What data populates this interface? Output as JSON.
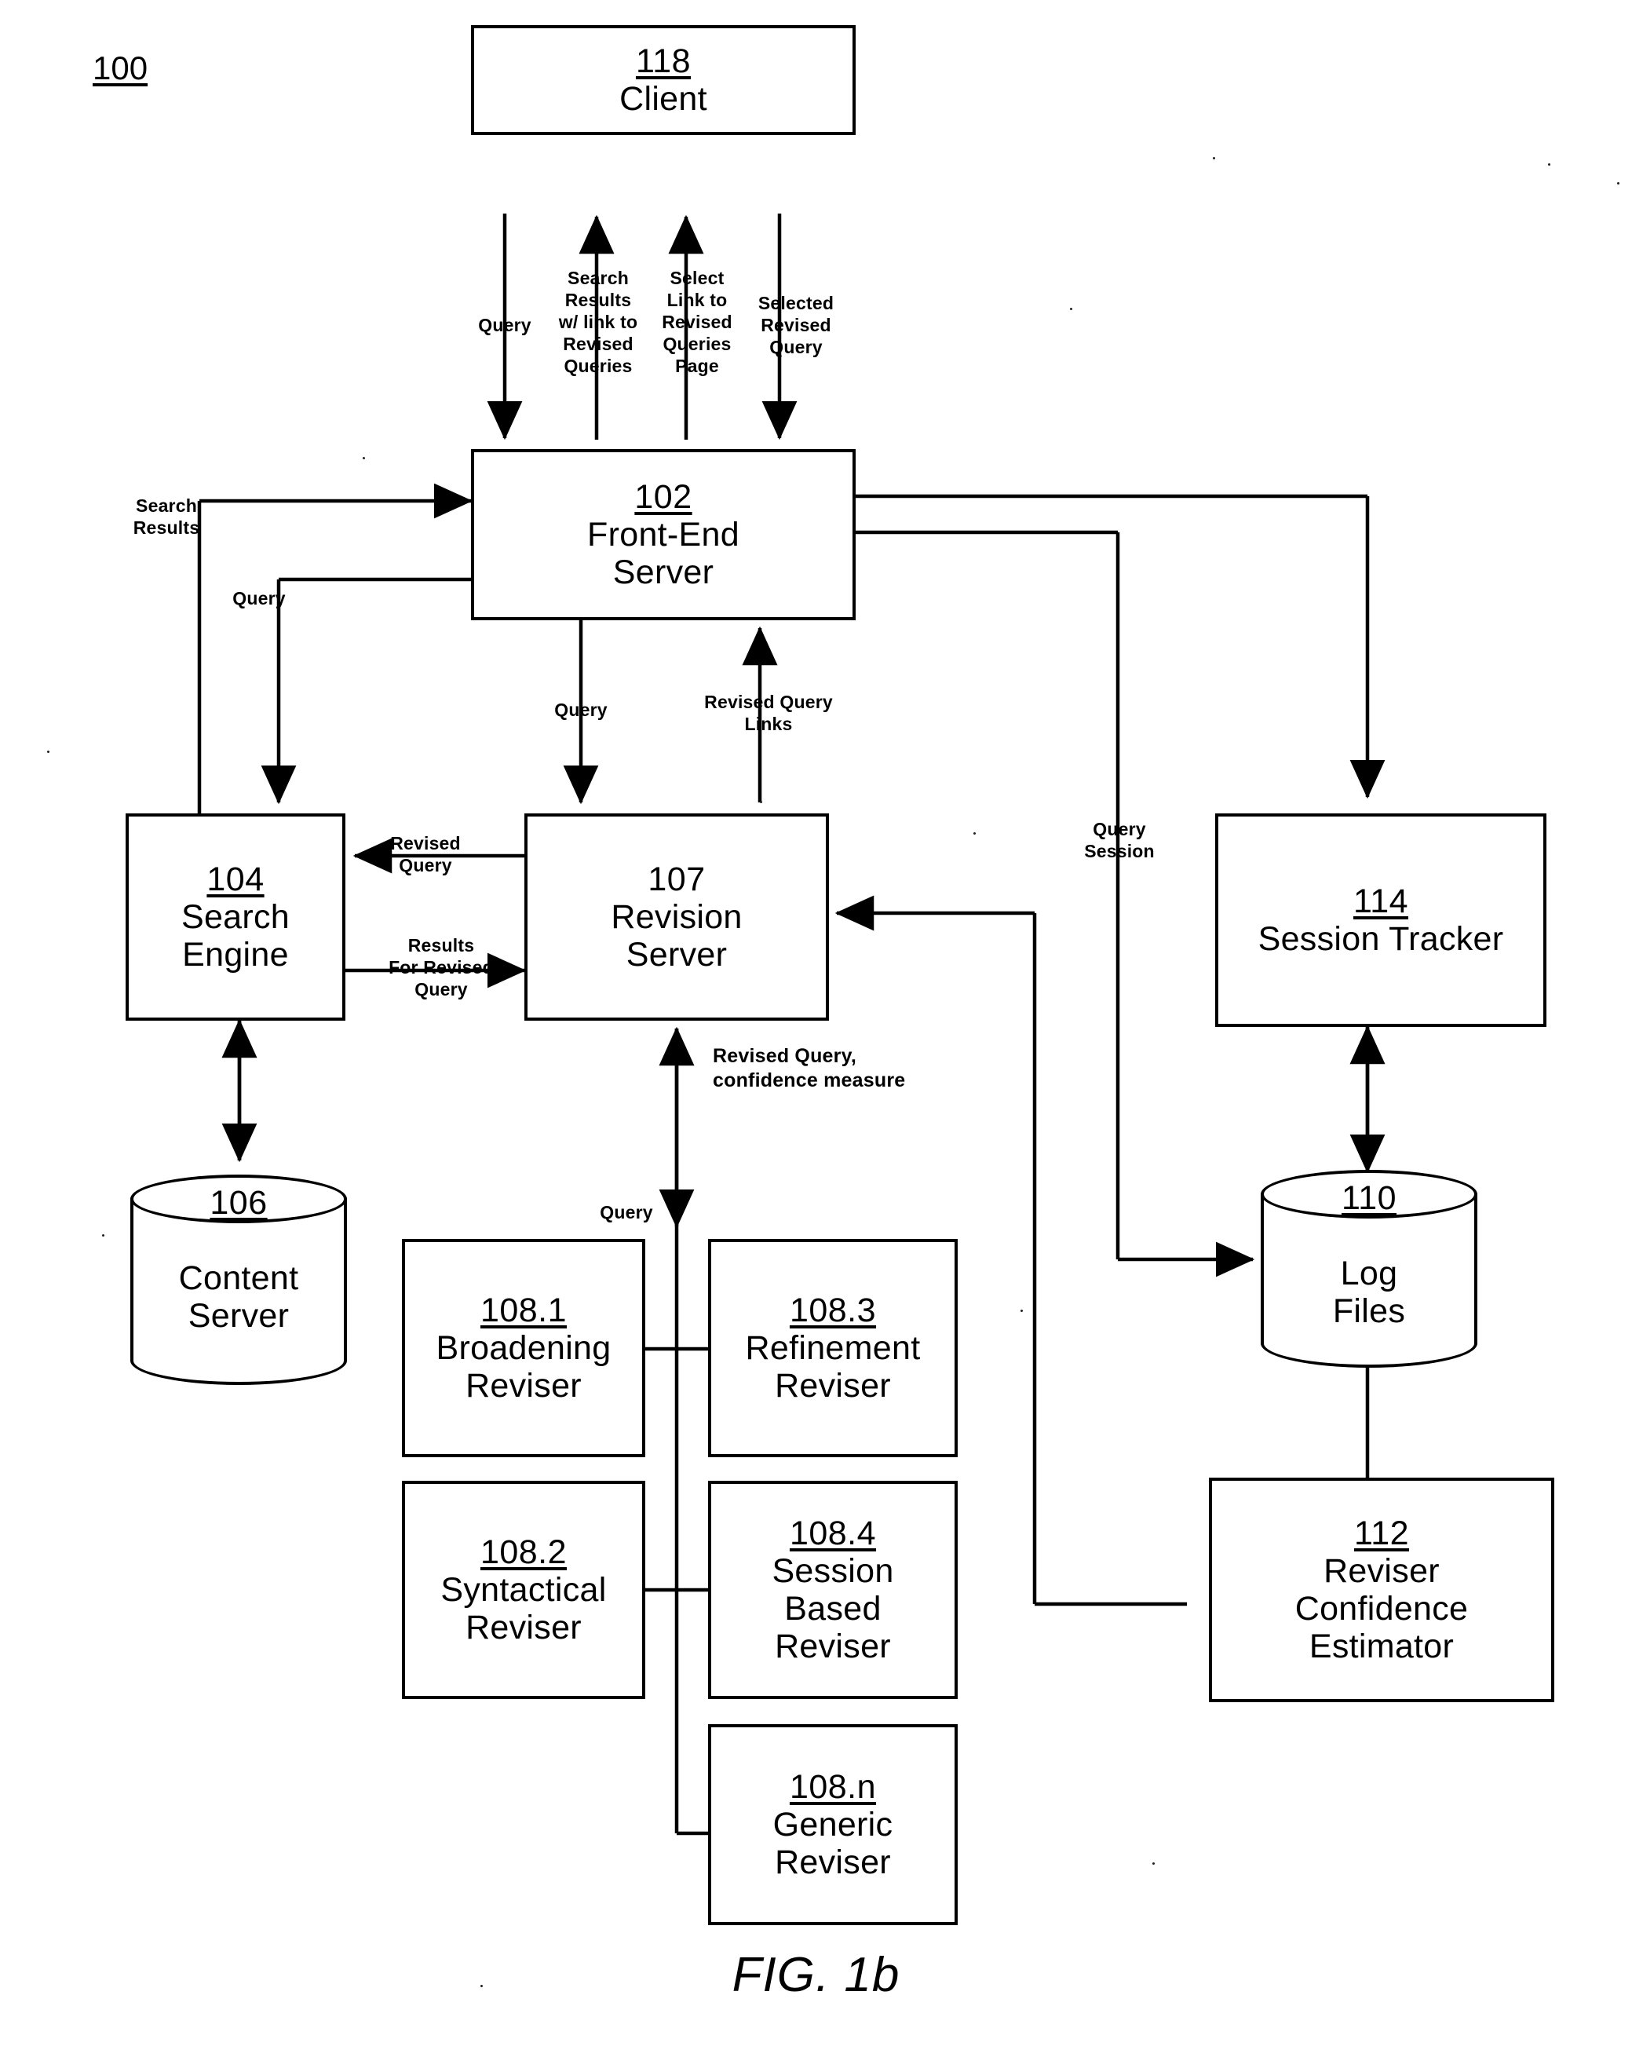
{
  "figure": {
    "number": "100",
    "caption": "FIG. 1b"
  },
  "nodes": {
    "client": {
      "ref": "118",
      "title": "Client"
    },
    "front_end": {
      "ref": "102",
      "title": "Front-End\nServer"
    },
    "search_engine": {
      "ref": "104",
      "title": "Search\nEngine"
    },
    "revision": {
      "ref": "107",
      "title": "Revision\nServer"
    },
    "session": {
      "ref": "114",
      "title": "Session Tracker"
    },
    "content": {
      "ref": "106",
      "title": "Content\nServer"
    },
    "logs": {
      "ref": "110",
      "title": "Log\nFiles"
    },
    "confidence": {
      "ref": "112",
      "title": "Reviser\nConfidence\nEstimator"
    },
    "broadening": {
      "ref": "108.1",
      "title": "Broadening\nReviser"
    },
    "refinement": {
      "ref": "108.3",
      "title": "Refinement\nReviser"
    },
    "syntactical": {
      "ref": "108.2",
      "title": "Syntactical\nReviser"
    },
    "session_based": {
      "ref": "108.4",
      "title": "Session\nBased\nReviser"
    },
    "generic": {
      "ref": "108.n",
      "title": "Generic\nReviser"
    }
  },
  "edge_labels": {
    "client_query": "Query",
    "search_results_w_link": "Search\nResults\nw/ link to\nRevised\nQueries",
    "select_link": "Select\nLink to\nRevised\nQueries\nPage",
    "selected_revised_query": "Selected\nRevised\nQuery",
    "search_results_in": "Search\nResults",
    "query_to_engine": "Query",
    "query_to_revision": "Query",
    "revised_query_links": "Revised Query\nLinks",
    "revised_query": "Revised\nQuery",
    "results_for_revised": "Results\nFor Revised\nQuery",
    "revised_query_conf": "Revised Query,\nconfidence measure",
    "query_to_revisers": "Query",
    "query_session": "Query\nSession"
  }
}
